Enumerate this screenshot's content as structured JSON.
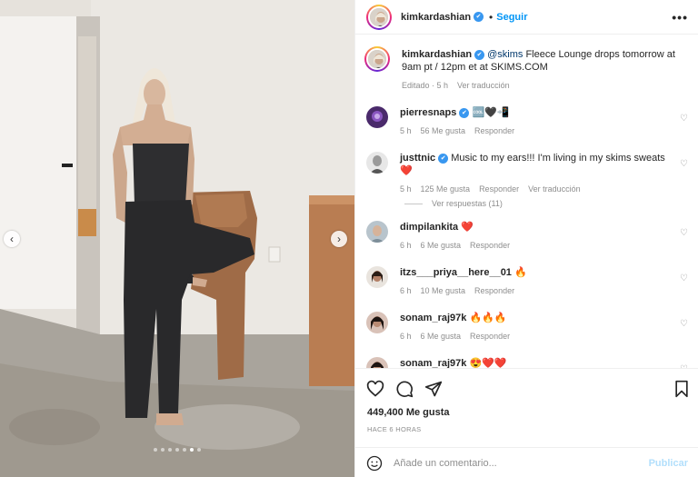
{
  "post": {
    "username": "kimkardashian",
    "follow_label": "Seguir",
    "separator": "•",
    "more_label": "•••",
    "nav_prev": "‹",
    "nav_next": "›",
    "carousel": {
      "count": 7,
      "active_index": 5
    }
  },
  "caption": {
    "username": "kimkardashian",
    "mention": "@skims",
    "text": " Fleece Lounge drops tomorrow at 9am pt / 12pm et at SKIMS.COM",
    "edited": "Editado",
    "time": "5 h",
    "translate": "Ver traducción"
  },
  "comments": [
    {
      "username": "pierresnaps",
      "verified": true,
      "text": "🆒🖤📲",
      "time": "5 h",
      "likes": "56 Me gusta",
      "reply": "Responder",
      "translate": ""
    },
    {
      "username": "justtnic",
      "verified": true,
      "text": "Music to my ears!!! I'm living in my skims sweats ❤️",
      "time": "5 h",
      "likes": "125 Me gusta",
      "reply": "Responder",
      "translate": "Ver traducción"
    },
    {
      "username": "dimpilankita",
      "verified": false,
      "text": "❤️",
      "time": "6 h",
      "likes": "6 Me gusta",
      "reply": "Responder",
      "translate": ""
    },
    {
      "username": "itzs___priya__here__01",
      "verified": false,
      "text": "🔥",
      "time": "6 h",
      "likes": "10 Me gusta",
      "reply": "Responder",
      "translate": ""
    },
    {
      "username": "sonam_raj97k",
      "verified": false,
      "text": "🔥🔥🔥",
      "time": "6 h",
      "likes": "6 Me gusta",
      "reply": "Responder",
      "translate": ""
    },
    {
      "username": "sonam_raj97k",
      "verified": false,
      "text": "😍❤️❤️",
      "time": "",
      "likes": "",
      "reply": "",
      "translate": ""
    }
  ],
  "view_replies": "Ver respuestas (11)",
  "actions": {
    "likes": "449,400 Me gusta",
    "time": "HACE 6 HORAS",
    "comment_placeholder": "Añade un comentario...",
    "publish": "Publicar"
  },
  "colors": {
    "link": "#0095f6",
    "verified": "#3897f0",
    "muted": "#8e8e8e"
  }
}
